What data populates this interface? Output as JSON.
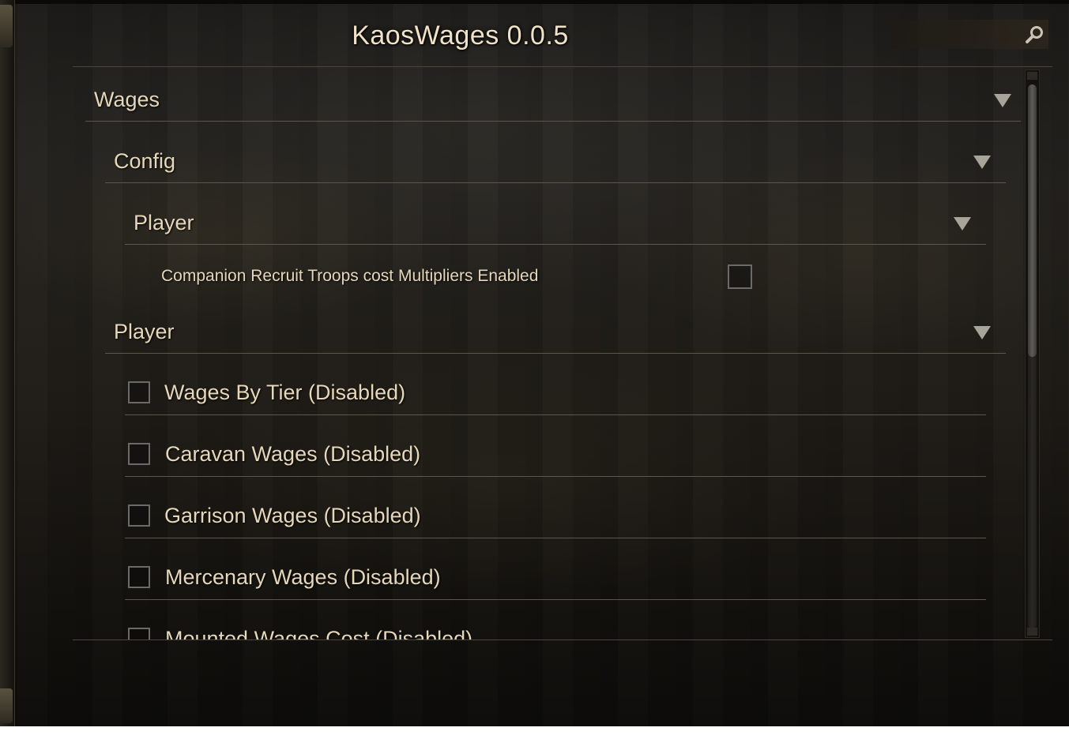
{
  "window": {
    "title": "KaosWages 0.0.5"
  },
  "search": {
    "placeholder": "",
    "value": ""
  },
  "sections": {
    "wages": {
      "label": "Wages"
    },
    "config": {
      "label": "Config"
    },
    "config_player": {
      "label": "Player"
    },
    "companion_option": {
      "label": "Companion Recruit Troops cost Multipliers Enabled",
      "checked": false
    },
    "player": {
      "label": "Player"
    }
  },
  "options": [
    {
      "label": "Wages By Tier (Disabled)",
      "checked": false
    },
    {
      "label": "Caravan Wages (Disabled)",
      "checked": false
    },
    {
      "label": "Garrison Wages (Disabled)",
      "checked": false
    },
    {
      "label": "Mercenary Wages (Disabled)",
      "checked": false
    },
    {
      "label": "Mounted Wages Cost (Disabled)",
      "checked": false
    }
  ],
  "colors": {
    "text": "#e6d7ba",
    "title": "#efe2c7",
    "divider": "#5b574c",
    "caret": "#a8a49a"
  },
  "icons": {
    "search": "magnifier-icon",
    "expand": "triangle-down-icon"
  }
}
